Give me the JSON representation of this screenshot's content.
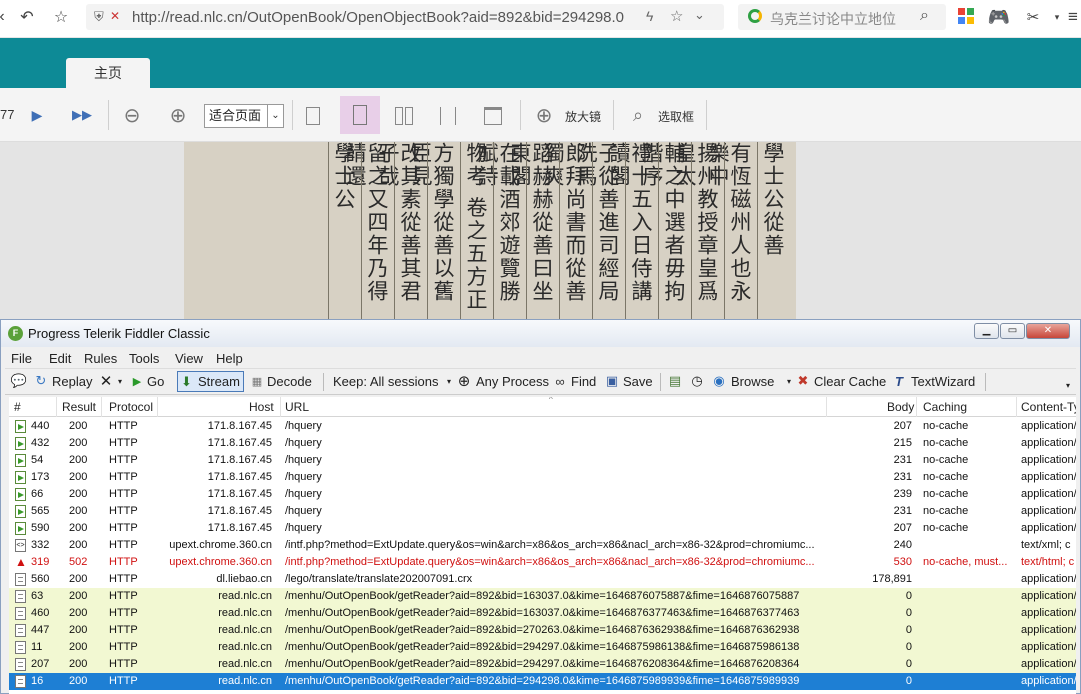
{
  "browser": {
    "url": "http://read.nlc.cn/OutOpenBook/OpenObjectBook?aid=892&bid=294298.0",
    "search_placeholder": "乌克兰讨论中立地位"
  },
  "site": {
    "home_tab": "主页"
  },
  "viewer": {
    "page_number": "77",
    "zoom_value": "适合页面",
    "magnifier_label": "放大镜",
    "select_box_label": "选取框"
  },
  "document": {
    "columns": [
      "學士公從善",
      "有恆磁州人也永樂中",
      "揚州教授章皇爲皇太",
      "輔之中選者毋拘階序",
      "禮十五入日侍講讀閣",
      "子從善進司經局洗馬",
      "郎拜尚書而從善獨爽",
      "蹈赫赫從善曰坐東閣",
      "在載酒郊遊覽勝賦詩",
      "物考 卷之五方正",
      "方獨學從善以舊臣見",
      "改其素從善其君子哉",
      "留之又四年乃得請還",
      "學士公"
    ]
  },
  "fiddler": {
    "title": "Progress Telerik Fiddler Classic",
    "menu": [
      "File",
      "Edit",
      "Rules",
      "Tools",
      "View",
      "Help"
    ],
    "toolbar": {
      "replay": "Replay",
      "go": "Go",
      "stream": "Stream",
      "decode": "Decode",
      "keep": "Keep: All sessions",
      "any_process": "Any Process",
      "find": "Find",
      "save": "Save",
      "browse": "Browse",
      "clear_cache": "Clear Cache",
      "text_wizard": "TextWizard"
    },
    "columns": [
      "#",
      "Result",
      "Protocol",
      "Host",
      "URL",
      "Body",
      "Caching",
      "Content-Ty"
    ],
    "rows": [
      {
        "id": "440",
        "result": "200",
        "protocol": "HTTP",
        "host": "171.8.167.45",
        "url": "/hquery",
        "body": "207",
        "caching": "no-cache",
        "ctype": "application/",
        "style": "normal",
        "icon": "arrow"
      },
      {
        "id": "432",
        "result": "200",
        "protocol": "HTTP",
        "host": "171.8.167.45",
        "url": "/hquery",
        "body": "215",
        "caching": "no-cache",
        "ctype": "application/",
        "style": "normal",
        "icon": "arrow"
      },
      {
        "id": "54",
        "result": "200",
        "protocol": "HTTP",
        "host": "171.8.167.45",
        "url": "/hquery",
        "body": "231",
        "caching": "no-cache",
        "ctype": "application/",
        "style": "normal",
        "icon": "arrow"
      },
      {
        "id": "173",
        "result": "200",
        "protocol": "HTTP",
        "host": "171.8.167.45",
        "url": "/hquery",
        "body": "231",
        "caching": "no-cache",
        "ctype": "application/",
        "style": "normal",
        "icon": "arrow"
      },
      {
        "id": "66",
        "result": "200",
        "protocol": "HTTP",
        "host": "171.8.167.45",
        "url": "/hquery",
        "body": "239",
        "caching": "no-cache",
        "ctype": "application/",
        "style": "normal",
        "icon": "arrow"
      },
      {
        "id": "565",
        "result": "200",
        "protocol": "HTTP",
        "host": "171.8.167.45",
        "url": "/hquery",
        "body": "231",
        "caching": "no-cache",
        "ctype": "application/",
        "style": "normal",
        "icon": "arrow"
      },
      {
        "id": "590",
        "result": "200",
        "protocol": "HTTP",
        "host": "171.8.167.45",
        "url": "/hquery",
        "body": "207",
        "caching": "no-cache",
        "ctype": "application/",
        "style": "normal",
        "icon": "arrow"
      },
      {
        "id": "332",
        "result": "200",
        "protocol": "HTTP",
        "host": "upext.chrome.360.cn",
        "url": "/intf.php?method=ExtUpdate.query&os=win&arch=x86&os_arch=x86&nacl_arch=x86-32&prod=chromiumc...",
        "body": "240",
        "caching": "",
        "ctype": "text/xml; c",
        "style": "normal",
        "icon": "xml"
      },
      {
        "id": "319",
        "result": "502",
        "protocol": "HTTP",
        "host": "upext.chrome.360.cn",
        "url": "/intf.php?method=ExtUpdate.query&os=win&arch=x86&os_arch=x86&nacl_arch=x86-32&prod=chromiumc...",
        "body": "530",
        "caching": "no-cache, must...",
        "ctype": "text/html; c",
        "style": "error",
        "icon": "warning"
      },
      {
        "id": "560",
        "result": "200",
        "protocol": "HTTP",
        "host": "dl.liebao.cn",
        "url": "/lego/translate/translate202007091.crx",
        "body": "178,891",
        "caching": "",
        "ctype": "application/",
        "style": "normal",
        "icon": "doc"
      },
      {
        "id": "63",
        "result": "200",
        "protocol": "HTTP",
        "host": "read.nlc.cn",
        "url": "/menhu/OutOpenBook/getReader?aid=892&bid=163037.0&kime=1646876075887&fime=1646876075887",
        "body": "0",
        "caching": "",
        "ctype": "application/",
        "style": "highlight",
        "icon": "doc"
      },
      {
        "id": "460",
        "result": "200",
        "protocol": "HTTP",
        "host": "read.nlc.cn",
        "url": "/menhu/OutOpenBook/getReader?aid=892&bid=163037.0&kime=1646876377463&fime=1646876377463",
        "body": "0",
        "caching": "",
        "ctype": "application/",
        "style": "highlight",
        "icon": "doc"
      },
      {
        "id": "447",
        "result": "200",
        "protocol": "HTTP",
        "host": "read.nlc.cn",
        "url": "/menhu/OutOpenBook/getReader?aid=892&bid=270263.0&kime=1646876362938&fime=1646876362938",
        "body": "0",
        "caching": "",
        "ctype": "application/",
        "style": "highlight",
        "icon": "doc"
      },
      {
        "id": "11",
        "result": "200",
        "protocol": "HTTP",
        "host": "read.nlc.cn",
        "url": "/menhu/OutOpenBook/getReader?aid=892&bid=294297.0&kime=1646875986138&fime=1646875986138",
        "body": "0",
        "caching": "",
        "ctype": "application/",
        "style": "highlight",
        "icon": "doc"
      },
      {
        "id": "207",
        "result": "200",
        "protocol": "HTTP",
        "host": "read.nlc.cn",
        "url": "/menhu/OutOpenBook/getReader?aid=892&bid=294297.0&kime=1646876208364&fime=1646876208364",
        "body": "0",
        "caching": "",
        "ctype": "application/",
        "style": "highlight",
        "icon": "doc"
      },
      {
        "id": "16",
        "result": "200",
        "protocol": "HTTP",
        "host": "read.nlc.cn",
        "url": "/menhu/OutOpenBook/getReader?aid=892&bid=294298.0&kime=1646875989939&fime=1646875989939",
        "body": "0",
        "caching": "",
        "ctype": "application/",
        "style": "selected",
        "icon": "doc"
      }
    ]
  },
  "colors": {
    "teal": "#0d8a96",
    "highlight_row": "#f2f8d2",
    "selected_row": "#1e7fd4",
    "error_text": "#d01010"
  }
}
